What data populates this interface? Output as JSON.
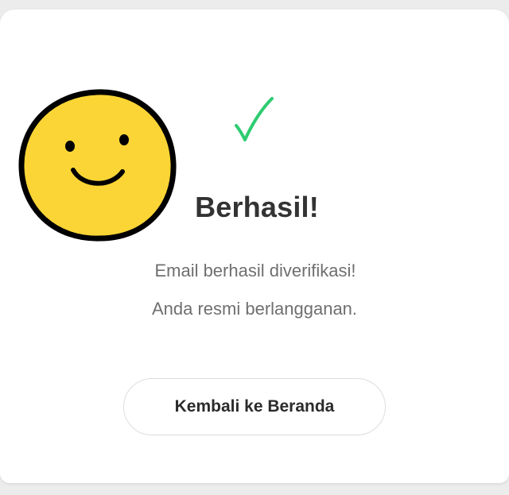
{
  "status": {
    "icon": "checkmark-icon",
    "icon_color": "#2ecc71",
    "title": "Berhasil!",
    "message_line1": "Email berhasil diverifikasi!",
    "message_line2": "Anda resmi berlangganan."
  },
  "sticker": {
    "icon": "smiley-face-icon",
    "fill_color": "#fbd535",
    "outline_color": "#000000"
  },
  "actions": {
    "home_label": "Kembali ke Beranda"
  }
}
